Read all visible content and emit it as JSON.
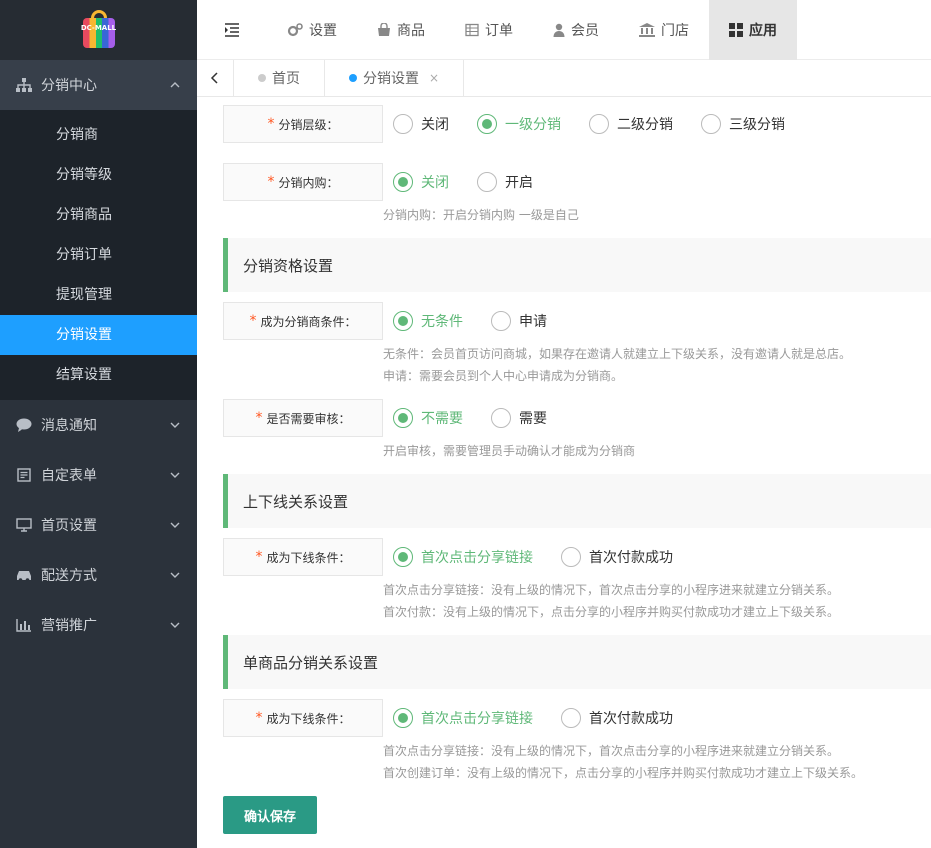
{
  "logo": {
    "text": "DC-MALL"
  },
  "sidebar": {
    "groups": [
      {
        "label": "分销中心",
        "icon": "sitemap-icon",
        "open": true,
        "items": [
          "分销商",
          "分销等级",
          "分销商品",
          "分销订单",
          "提现管理",
          "分销设置",
          "结算设置"
        ],
        "active_index": 5
      },
      {
        "label": "消息通知",
        "icon": "comment-icon"
      },
      {
        "label": "自定表单",
        "icon": "form-icon"
      },
      {
        "label": "首页设置",
        "icon": "monitor-icon"
      },
      {
        "label": "配送方式",
        "icon": "car-icon"
      },
      {
        "label": "营销推广",
        "icon": "bar-chart-icon"
      }
    ]
  },
  "topnav": {
    "items": [
      {
        "label": "设置",
        "icon": "gears-icon"
      },
      {
        "label": "商品",
        "icon": "shopping-bag-icon"
      },
      {
        "label": "订单",
        "icon": "list-table-icon"
      },
      {
        "label": "会员",
        "icon": "user-icon"
      },
      {
        "label": "门店",
        "icon": "bank-icon"
      },
      {
        "label": "应用",
        "icon": "grid-icon",
        "active": true
      }
    ]
  },
  "tabs": [
    {
      "label": "首页"
    },
    {
      "label": "分销设置",
      "active": true,
      "close": "×"
    }
  ],
  "form": {
    "level": {
      "label": "分销层级：",
      "options": [
        "关闭",
        "一级分销",
        "二级分销",
        "三级分销"
      ],
      "selected": 1
    },
    "self_buy": {
      "label": "分销内购：",
      "options": [
        "关闭",
        "开启"
      ],
      "selected": 0,
      "hint": "分销内购：开启分销内购 一级是自己"
    },
    "section_qualify": "分销资格设置",
    "become_condition": {
      "label": "成为分销商条件：",
      "options": [
        "无条件",
        "申请"
      ],
      "selected": 0,
      "hint1": "无条件：会员首页访问商城，如果存在邀请人就建立上下级关系，没有邀请人就是总店。",
      "hint2": "申请：需要会员到个人中心申请成为分销商。"
    },
    "need_review": {
      "label": "是否需要审核：",
      "options": [
        "不需要",
        "需要"
      ],
      "selected": 0,
      "hint": "开启审核，需要管理员手动确认才能成为分销商"
    },
    "section_relation": "上下线关系设置",
    "downline_condition": {
      "label": "成为下线条件：",
      "options": [
        "首次点击分享链接",
        "首次付款成功"
      ],
      "selected": 0,
      "hint1": "首次点击分享链接：没有上级的情况下，首次点击分享的小程序进来就建立分销关系。",
      "hint2": "首次付款：没有上级的情况下，点击分享的小程序并购买付款成功才建立上下级关系。"
    },
    "section_single": "单商品分销关系设置",
    "single_condition": {
      "label": "成为下线条件：",
      "options": [
        "首次点击分享链接",
        "首次付款成功"
      ],
      "selected": 0,
      "hint1": "首次点击分享链接：没有上级的情况下，首次点击分享的小程序进来就建立分销关系。",
      "hint2": "首次创建订单：没有上级的情况下，点击分享的小程序并购买付款成功才建立上下级关系。"
    },
    "required_mark": "*",
    "save_label": "确认保存"
  },
  "colors": {
    "accent": "#5fb878",
    "active_sub": "#1e9fff",
    "save": "#2a9a85",
    "sidebar": "#2b323b",
    "required": "#ff5722"
  }
}
